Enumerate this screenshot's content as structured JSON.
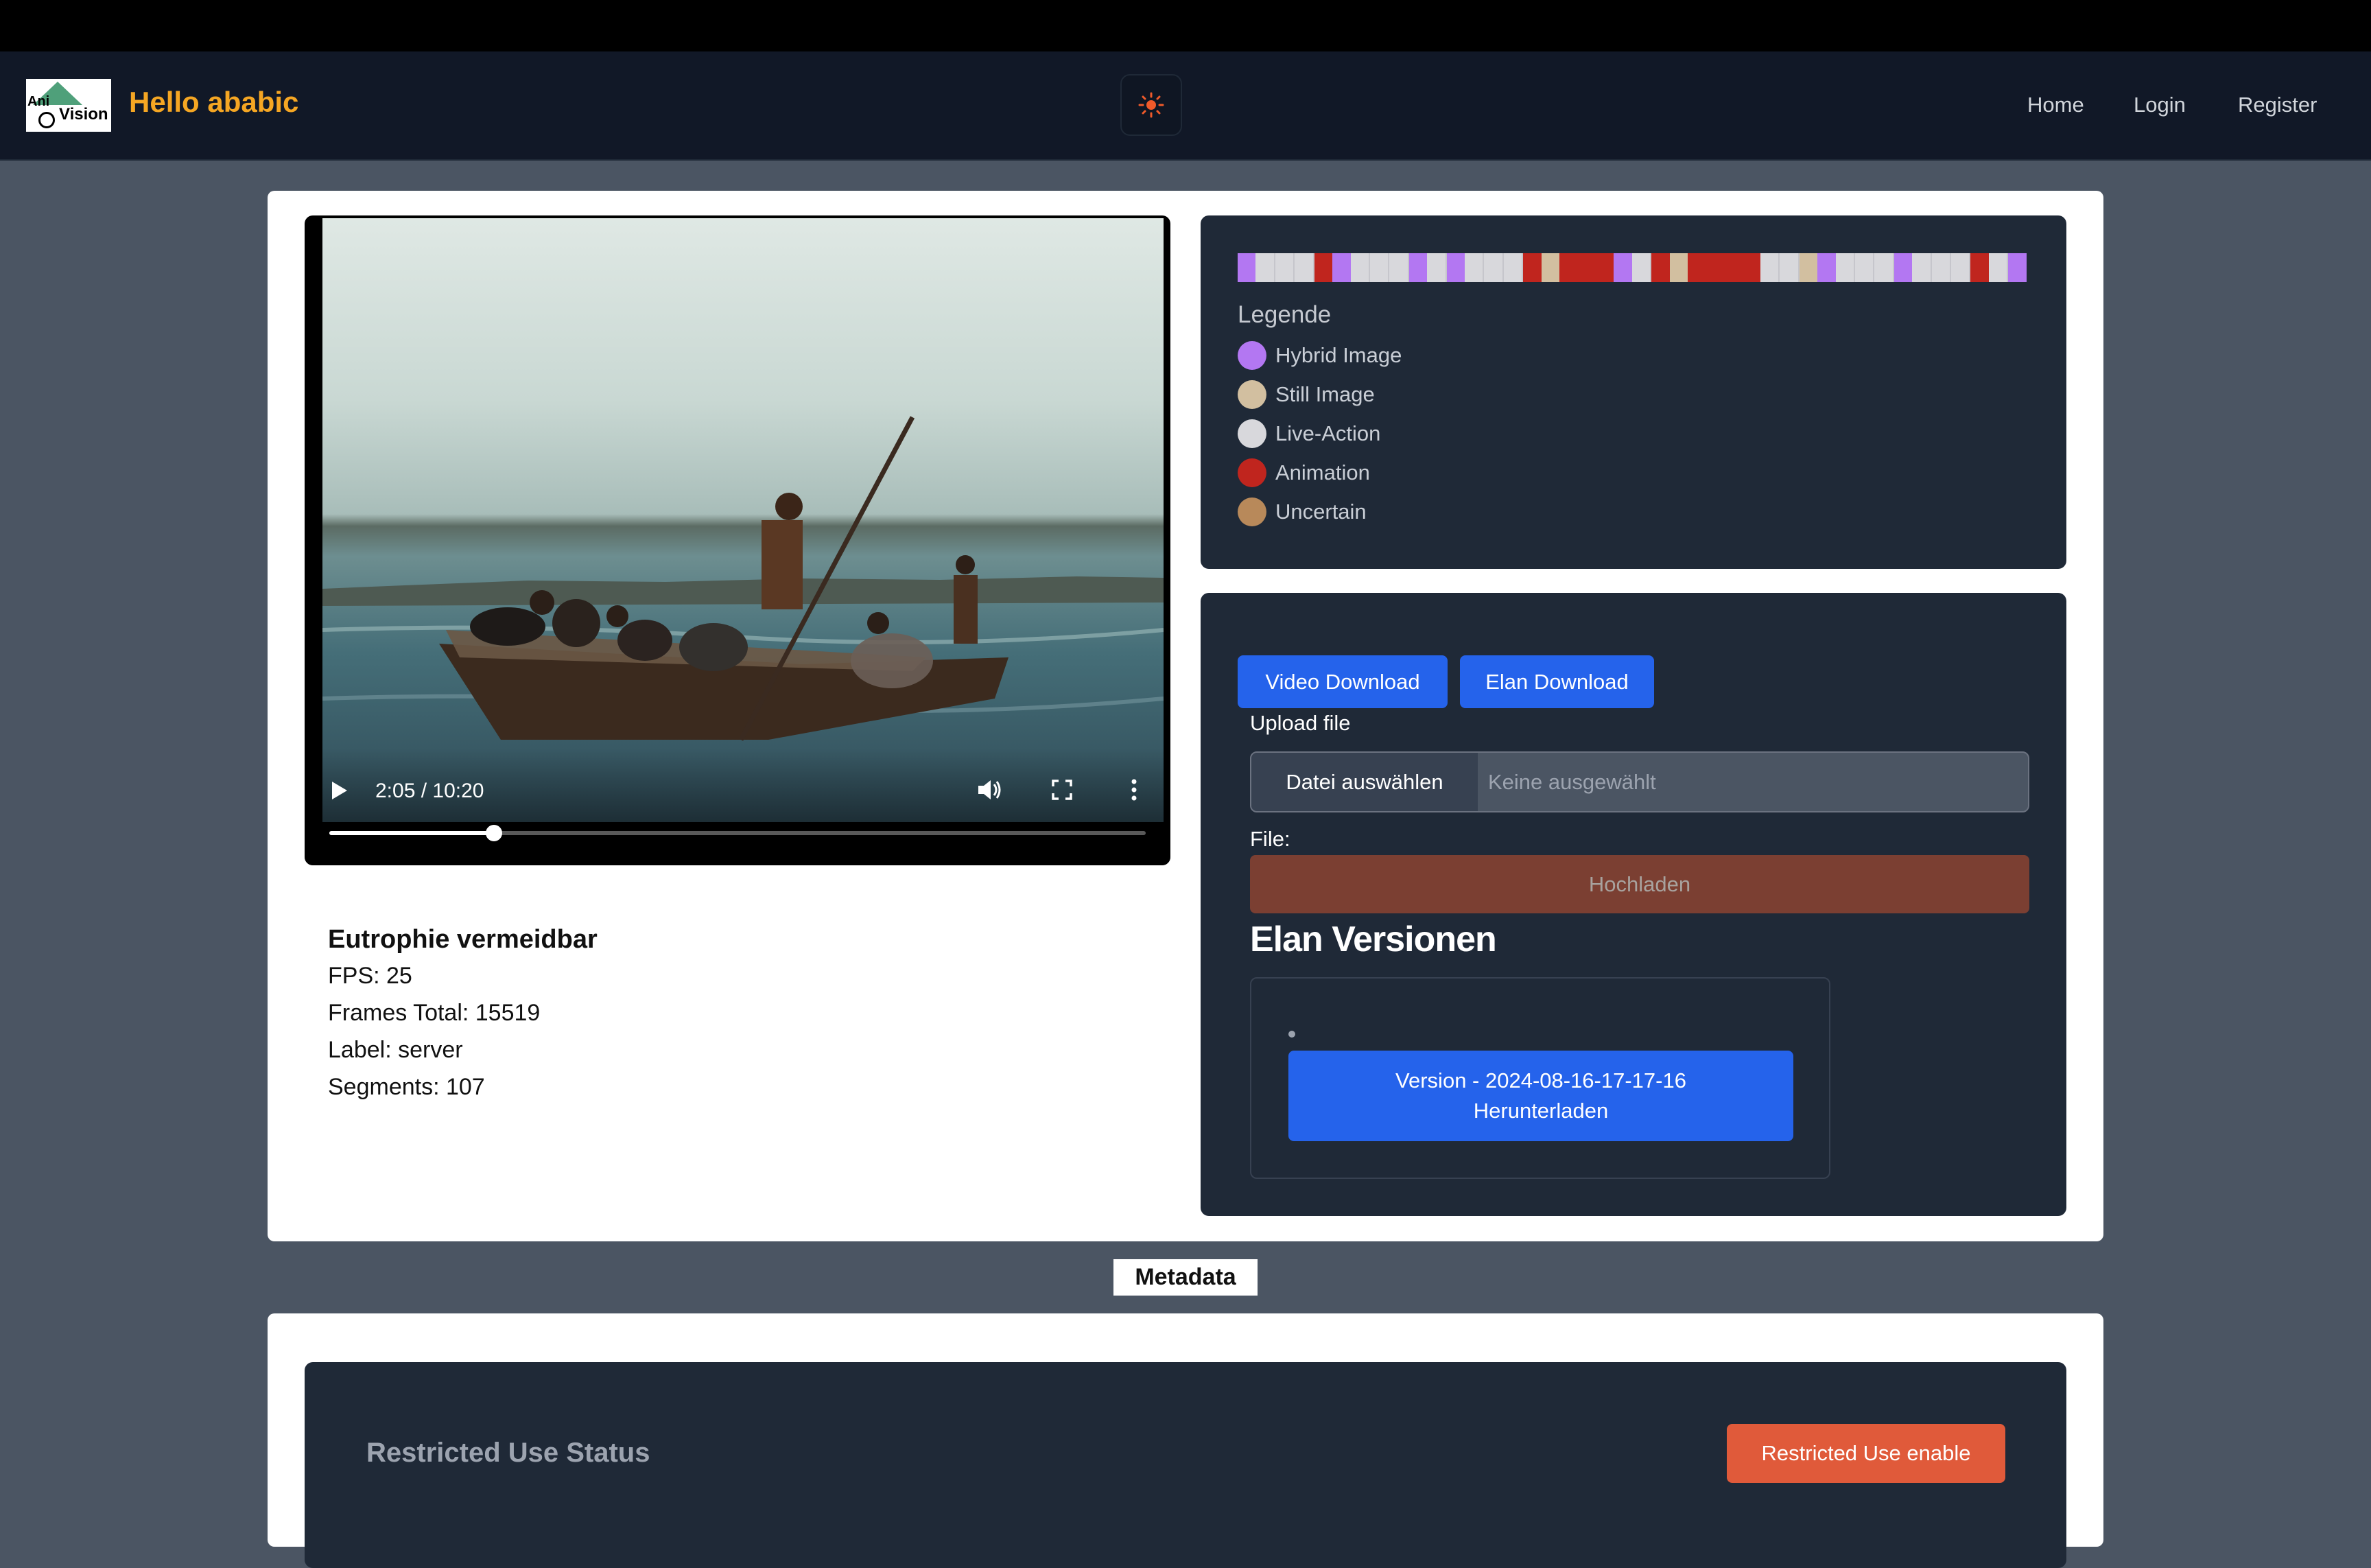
{
  "navbar": {
    "greeting": "Hello ababic",
    "logo_text_ani": "Ani",
    "logo_text_vision": "Vision",
    "theme_toggle_icon": "sun-icon",
    "links": [
      "Home",
      "Login",
      "Register"
    ]
  },
  "video": {
    "time_display": "2:05 / 10:20",
    "progress_fraction": 0.2016,
    "icons": [
      "play-icon",
      "volume-icon",
      "fullscreen-icon",
      "more-options-icon"
    ]
  },
  "info": {
    "title": "Eutrophie vermeidbar",
    "fps": "FPS: 25",
    "frames_total": "Frames Total: 15519",
    "label": "Label: server",
    "segments": "Segments: 107"
  },
  "legend": {
    "title": "Legende",
    "items": [
      {
        "label": "Hybrid Image",
        "color": "#b377f2"
      },
      {
        "label": "Still Image",
        "color": "#d2bfa0"
      },
      {
        "label": "Live-Action",
        "color": "#d8d8dc"
      },
      {
        "label": "Animation",
        "color": "#c0251e"
      },
      {
        "label": "Uncertain",
        "color": "#b8895a"
      }
    ],
    "timeline_sequence": [
      "hybrid",
      "live",
      "live",
      "live",
      "animation",
      "hybrid",
      "live",
      "live",
      "live",
      "hybrid",
      "live",
      "hybrid",
      "live",
      "live",
      "live",
      "animation",
      "still",
      "animation",
      "animation",
      "animation",
      "hybrid",
      "live",
      "animation",
      "still",
      "animation",
      "animation",
      "animation",
      "animation",
      "live",
      "live",
      "still",
      "hybrid",
      "live",
      "live",
      "live",
      "hybrid",
      "live",
      "live",
      "live",
      "animation",
      "live",
      "hybrid"
    ]
  },
  "downloads": {
    "video_download": "Video Download",
    "elan_download": "Elan Download",
    "upload_file_label": "Upload file",
    "choose_file": "Datei auswählen",
    "no_file": "Keine ausgewählt",
    "file_label": "File:",
    "upload_button": "Hochladen",
    "versions_title": "Elan Versionen",
    "version_line1": "Version - 2024-08-16-17-17-16",
    "version_line2": "Herunterladen"
  },
  "metadata": {
    "label": "Metadata",
    "restricted_title": "Restricted Use Status",
    "restricted_button": "Restricted Use enable"
  },
  "colors": {
    "primary": "#2563eb",
    "brand": "#f5a623",
    "panel": "#1f2937",
    "danger": "#e05a3a"
  }
}
